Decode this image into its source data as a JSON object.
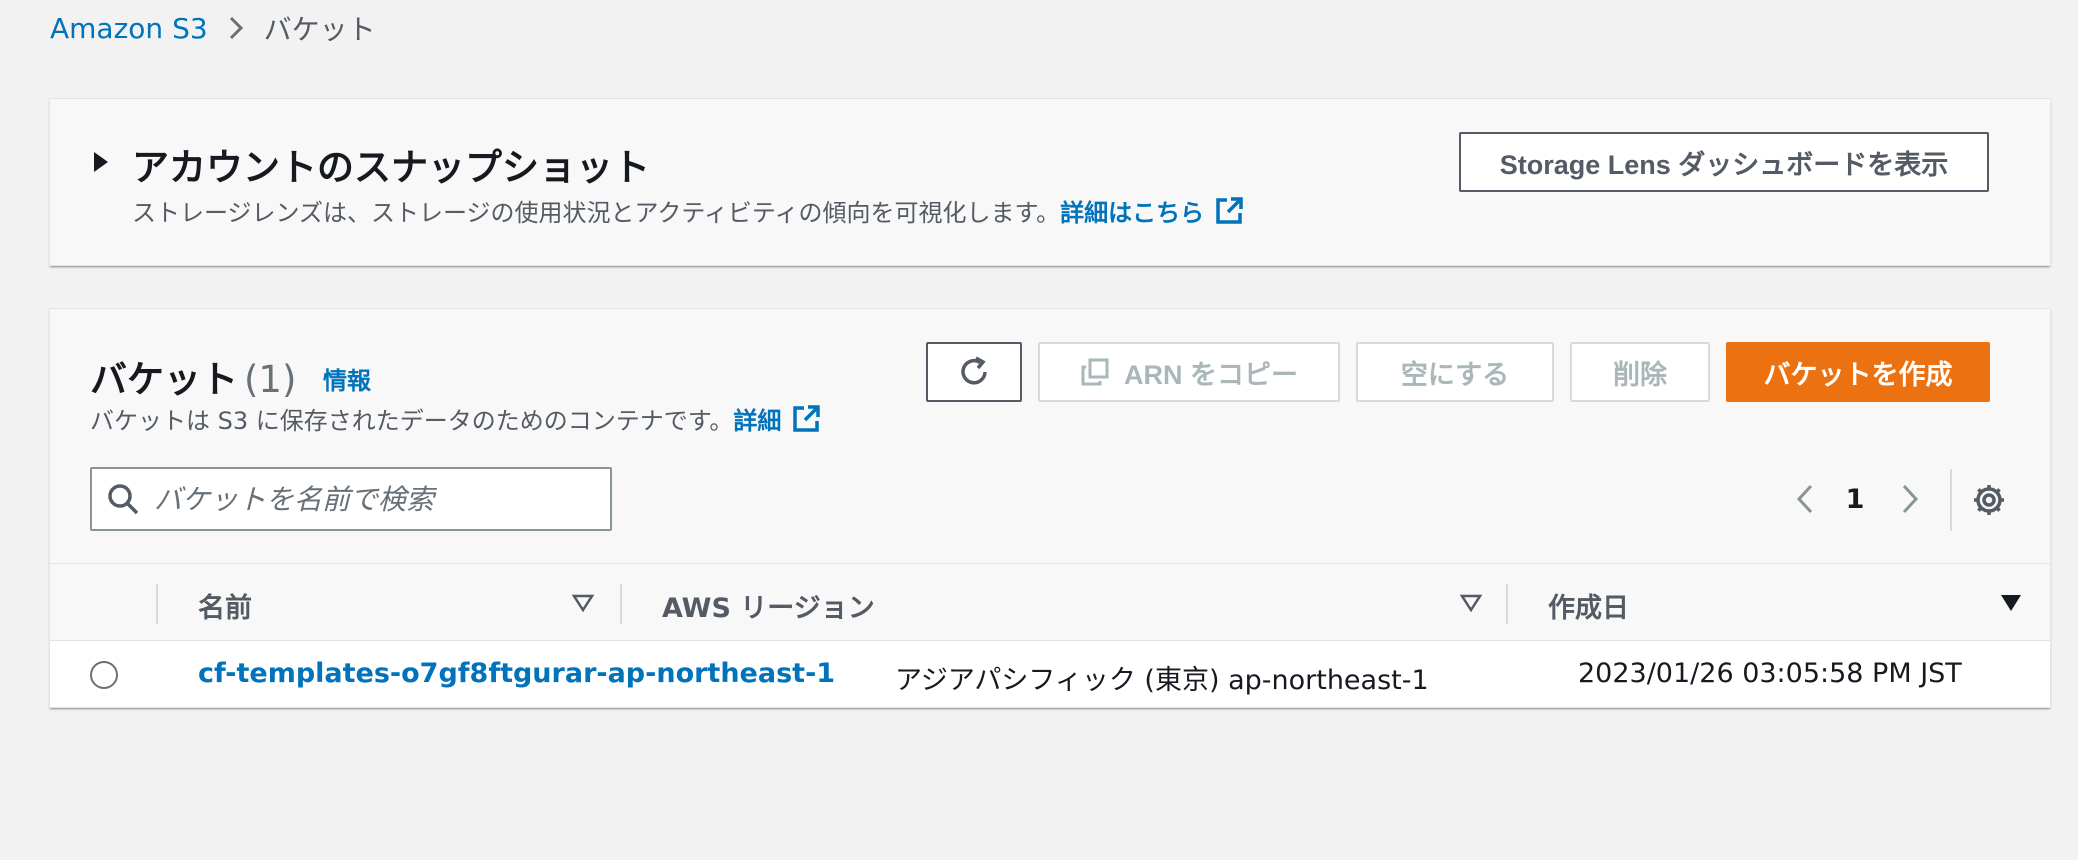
{
  "breadcrumb": {
    "root": "Amazon S3",
    "current": "バケット"
  },
  "snapshot": {
    "title": "アカウントのスナップショット",
    "description": "ストレージレンズは、ストレージの使用状況とアクティビティの傾向を可視化します。",
    "details_link": "詳細はこちら",
    "dashboard_button": "Storage Lens ダッシュボードを表示"
  },
  "buckets": {
    "title": "バケット",
    "count": "(1)",
    "info_link": "情報",
    "description": "バケットは S3 に保存されたデータのためのコンテナです。",
    "details_link": "詳細",
    "actions": {
      "copy_arn": "ARN をコピー",
      "empty": "空にする",
      "delete": "削除",
      "create": "バケットを作成"
    },
    "search_placeholder": "バケットを名前で検索",
    "pagination": {
      "current_page": "1"
    },
    "columns": {
      "name": "名前",
      "region": "AWS リージョン",
      "created": "作成日"
    },
    "rows": [
      {
        "name": "cf-templates-o7gf8ftgurar-ap-northeast-1",
        "region": "アジアパシフィック (東京) ap-northeast-1",
        "created": "2023/01/26 03:05:58 PM JST"
      }
    ]
  },
  "colors": {
    "link": "#0073bb",
    "primary": "#ec7211",
    "background": "#f1f2f1",
    "panel": "#f8f8f8"
  },
  "icons": {
    "breadcrumb_separator": "chevron-right-icon",
    "snapshot_toggle": "caret-right-icon",
    "external_link": "external-link-icon",
    "refresh": "refresh-icon",
    "copy": "copy-icon",
    "search": "search-icon",
    "pager_prev": "chevron-left-icon",
    "pager_next": "chevron-right-icon",
    "settings": "gear-icon",
    "sort": "sort-down-icon"
  }
}
